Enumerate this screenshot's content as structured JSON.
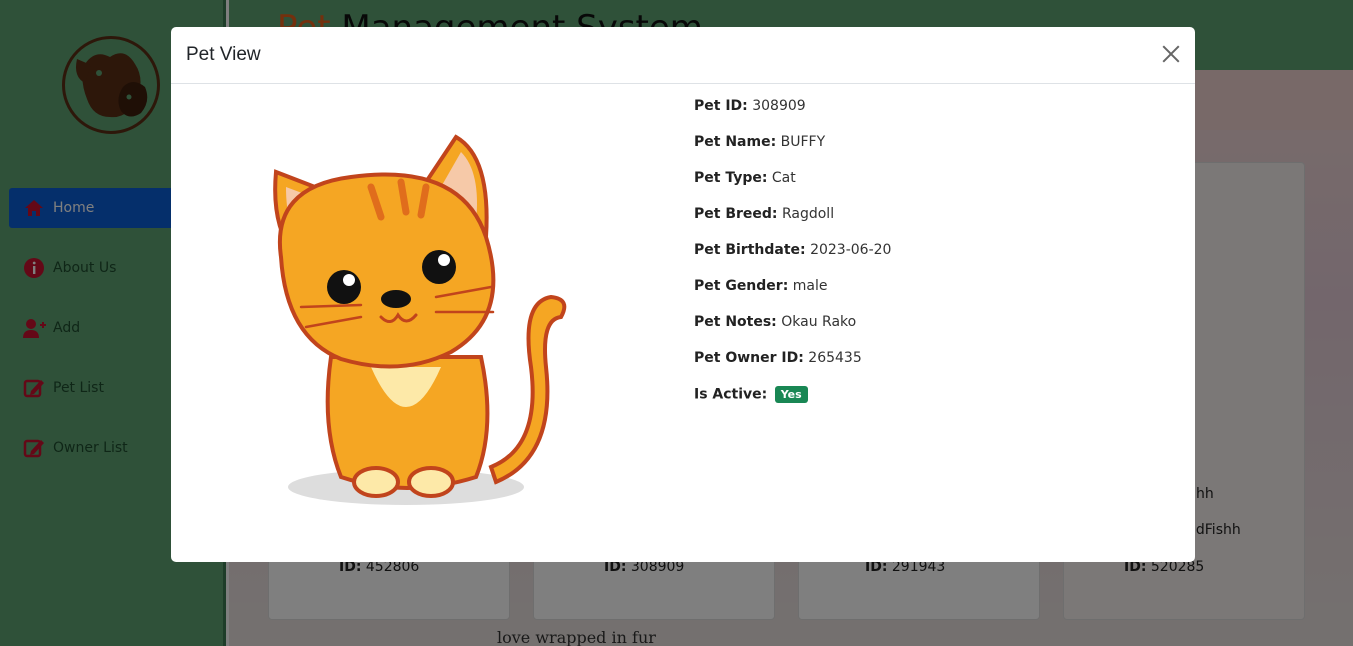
{
  "app": {
    "title_accent": "Pet",
    "title_rest": " Management System"
  },
  "sidebar": {
    "items": [
      {
        "label": "Home",
        "icon": "home-icon",
        "active": true
      },
      {
        "label": "About Us",
        "icon": "info-icon"
      },
      {
        "label": "Add",
        "icon": "add-user-icon"
      },
      {
        "label": "Pet List",
        "icon": "edit-icon"
      },
      {
        "label": "Owner List",
        "icon": "edit-icon"
      }
    ]
  },
  "cards": [
    {
      "id_label": "ID:",
      "id_value": "452806"
    },
    {
      "id_label": "ID:",
      "id_value": "308909"
    },
    {
      "id_label": "ID:",
      "id_value": "291943"
    },
    {
      "id_label": "ID:",
      "id_value": "520285",
      "partial_1": "hh",
      "partial_2": "ldFishh"
    }
  ],
  "background_text": "love wrapped in fur",
  "modal": {
    "title": "Pet View",
    "fields": [
      {
        "label": "Pet ID:",
        "value": "308909"
      },
      {
        "label": "Pet Name:",
        "value": "BUFFY"
      },
      {
        "label": "Pet Type:",
        "value": "Cat"
      },
      {
        "label": "Pet Breed:",
        "value": "Ragdoll"
      },
      {
        "label": "Pet Birthdate:",
        "value": "2023-06-20"
      },
      {
        "label": "Pet Gender:",
        "value": "male"
      },
      {
        "label": "Pet Notes:",
        "value": "Okau Rako"
      },
      {
        "label": "Pet Owner ID:",
        "value": "265435"
      }
    ],
    "active_label": "Is Active:",
    "active_badge": "Yes"
  },
  "colors": {
    "sidebar": "#5fa273",
    "active_nav": "#0b5ed7",
    "badge": "#198754",
    "icon_red": "#c8102e"
  }
}
